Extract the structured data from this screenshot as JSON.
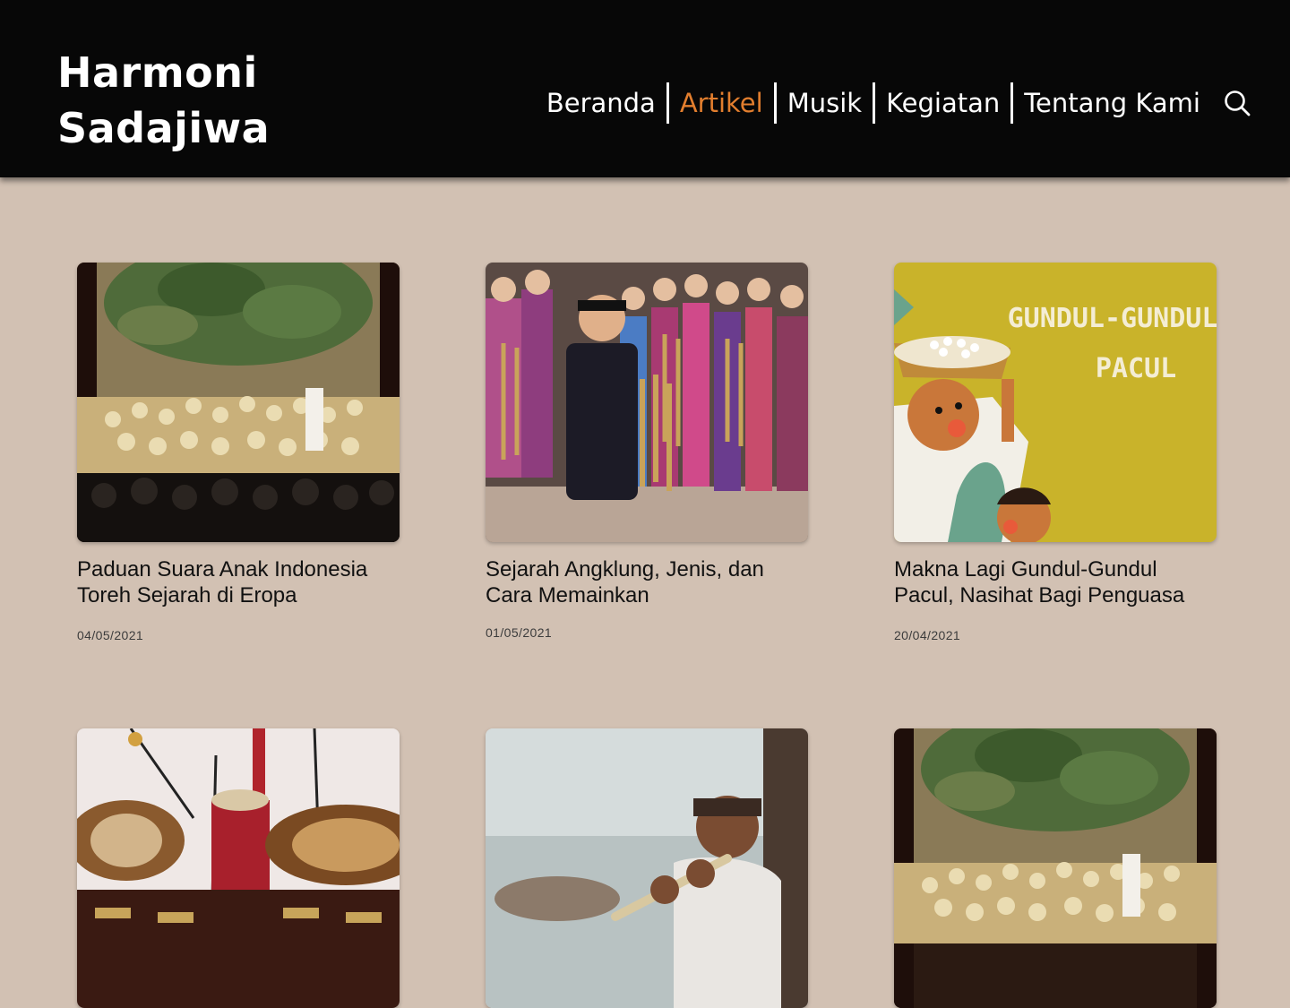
{
  "site": {
    "logo_line1": "Harmoni",
    "logo_line2": "Sadajiwa"
  },
  "nav": {
    "items": [
      "Beranda",
      "Artikel",
      "Musik",
      "Kegiatan",
      "Tentang Kami"
    ],
    "active": "Artikel",
    "search_icon": "search-icon"
  },
  "colors": {
    "header_bg": "#070707",
    "page_bg": "#d2c1b3",
    "accent": "#e27e2e"
  },
  "articles": [
    {
      "title": "Paduan Suara Anak Indonesia Toreh Sejarah di Eropa",
      "date": "04/05/2021",
      "image": "choir-performance-photo"
    },
    {
      "title": "Sejarah Angklung, Jenis, dan Cara Memainkan",
      "date": "01/05/2021",
      "image": "angklung-children-photo"
    },
    {
      "title": "Makna Lagi Gundul-Gundul Pacul, Nasihat Bagi Penguasa",
      "date": "20/04/2021",
      "image": "gundul-pacul-illustration",
      "image_text": "GUNDUL-GUNDUL PACUL"
    },
    {
      "title": "",
      "date": "",
      "image": "gamelan-drums-photo"
    },
    {
      "title": "",
      "date": "",
      "image": "flute-boy-photo"
    },
    {
      "title": "",
      "date": "",
      "image": "choir-performance-photo"
    }
  ]
}
